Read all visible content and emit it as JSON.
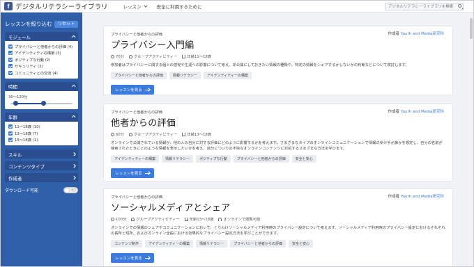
{
  "header": {
    "title": "デジタルリテラシーライブラリ",
    "logo_letter": "f",
    "nav": [
      {
        "label": "レッスン"
      },
      {
        "label": "安全に利用するために"
      }
    ],
    "search_placeholder": "デジタルリテラシーライブラリを検索"
  },
  "sidebar": {
    "filter_title": "レッスンを絞り込む",
    "reset_label": "リセット",
    "modules": {
      "label": "モジュール",
      "items": [
        {
          "label": "プライバシーと他者からの評価 (4)",
          "checked": true
        },
        {
          "label": "アイデンティティの構築 (3)",
          "checked": true
        },
        {
          "label": "ポジティブな行動 (2)",
          "checked": true
        },
        {
          "label": "セキュリティ (2)",
          "checked": true
        },
        {
          "label": "コミュニティとの交流 (4)",
          "checked": true
        }
      ]
    },
    "time": {
      "label": "時間",
      "range_label": "30〜120分",
      "range_min": 30,
      "range_max": 120
    },
    "age": {
      "label": "年齢",
      "items": [
        {
          "label": "11〜18歳 (10)",
          "checked": true
        },
        {
          "label": "13〜18歳 (7)",
          "checked": true
        },
        {
          "label": "15〜18歳 (1)",
          "checked": true
        }
      ]
    },
    "collapsed": [
      {
        "label": "スキル"
      },
      {
        "label": "コンテンツタイプ"
      },
      {
        "label": "作成者"
      }
    ],
    "download_label": "ダウンロード可能",
    "toggle_text": "オフ"
  },
  "lessons": [
    {
      "category": "プライバシーと他者からの評価",
      "author_prefix": "作成者",
      "author": "Youth and Media研究科",
      "title": "プライバシー入門編",
      "duration": "70分",
      "activity": "グループアクティビティー",
      "age": "年齢11〜18歳",
      "online": "",
      "description": "参加者はプライバシーに関する個人の感覚や生涯への影響について考え、非公開にしておきたい情報の種類や、特定の情報をシェアするかしないかの判断などについて検討します。",
      "tags": [
        "プライバシーと他者からの評価",
        "情報リテラシー",
        "アイデンティティーの構築"
      ],
      "button": "レッスンを見る"
    },
    {
      "category": "プライバシーと他者からの評価",
      "author_prefix": "作成者",
      "author": "Youth and Media研究科",
      "title": "他者からの評価",
      "duration": "60分",
      "activity": "グループアクティビティー",
      "age": "年齢13〜18歳",
      "online": "",
      "description": "オンラインで公開されている情報が、他の人の自分に対する評価にどのように影響するかを考えます。さまざまなタイプのオンラインコミュニケーションで情報の受け手が誰かを想定し、自分の名前が検索されたときにどのような情報を表示したいかを考え、自分についての不快なオンラインコンテンツに対処するさまざまな方法を学びます。",
      "tags": [
        "アイデンティティーの構築",
        "情報リテラシー",
        "ポジティブな行動",
        "プライバシーと他者からの評価",
        "安全と安心"
      ],
      "button": "レッスンを見る"
    },
    {
      "category": "プライバシーと他者からの評価",
      "author_prefix": "作成者",
      "author": "Youth and Media研究科",
      "title": "ソーシャルメディアとシェア",
      "duration": "100分",
      "activity": "グループアクティビティー",
      "age": "年齢13〜18歳",
      "online": "オンラインで閲覧可能",
      "description": "オンラインでの情報のシェアやコミュニケーションにおいて、とりわけソーシャルメディア利用時のプライバシー設定について考えます。ソーシャルメディア利用時のプライバシー設定におけるそれぞれの長所と短所、およびオンライン全般における効果的なプライバシー設定方法を学びことができます。",
      "tags": [
        "コンテンツ制作",
        "アイデンティティーの構築",
        "情報リテラシー",
        "プライバシーと他者からの評価",
        "安全と安心"
      ],
      "button": "レッスンを見る"
    }
  ]
}
